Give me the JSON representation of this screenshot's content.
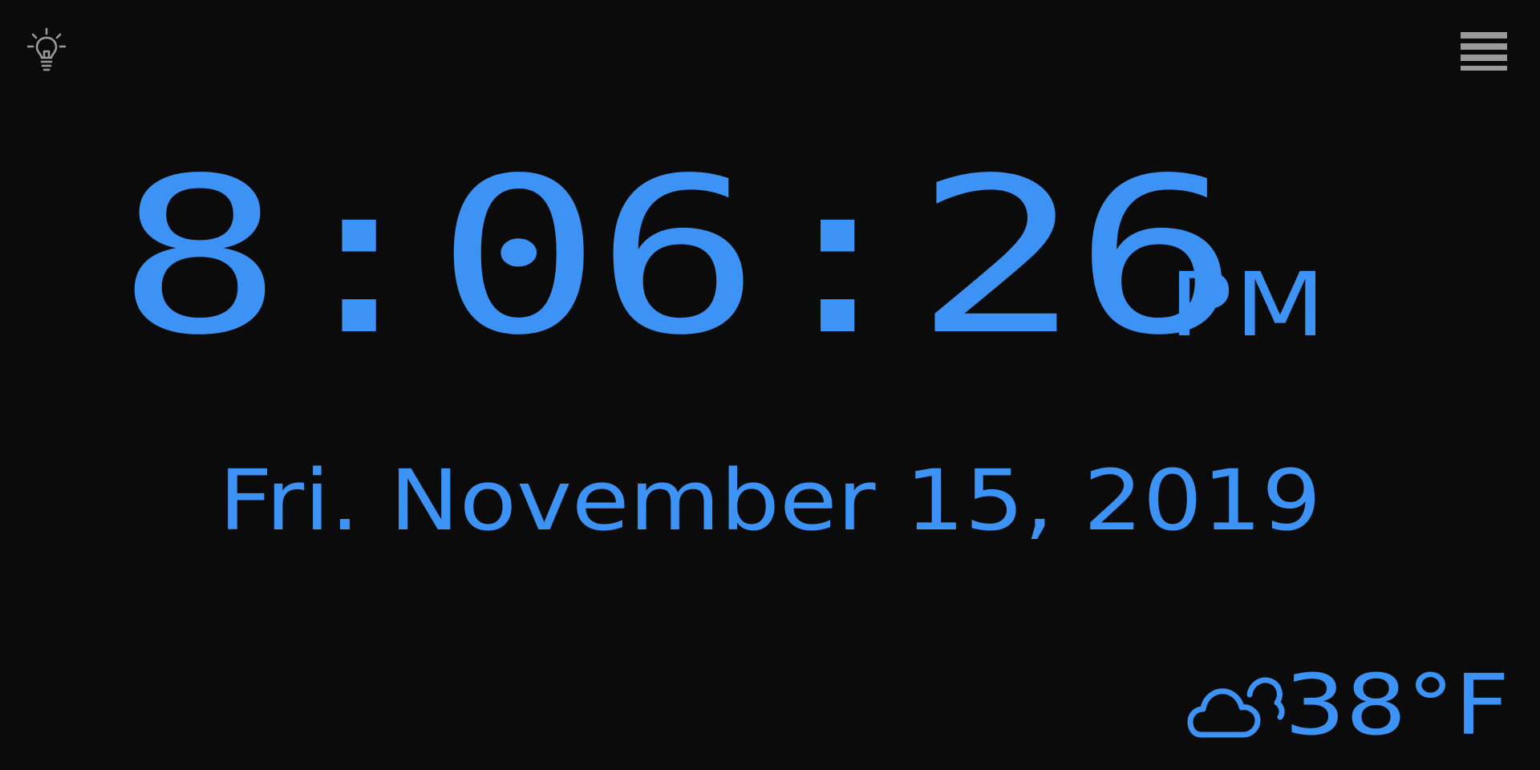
{
  "toolbar": {
    "left_icon": "lightbulb-icon",
    "right_icon": "hamburger-menu-icon"
  },
  "clock": {
    "time": "8:06:26",
    "meridiem": "PM"
  },
  "date": {
    "text": "Fri. November 15, 2019"
  },
  "weather": {
    "icon": "cloud-icon",
    "temperature": "38°F"
  },
  "colors": {
    "background": "#0b0b0b",
    "accent": "#3d93f5",
    "icon_gray": "#9a9a9a"
  }
}
